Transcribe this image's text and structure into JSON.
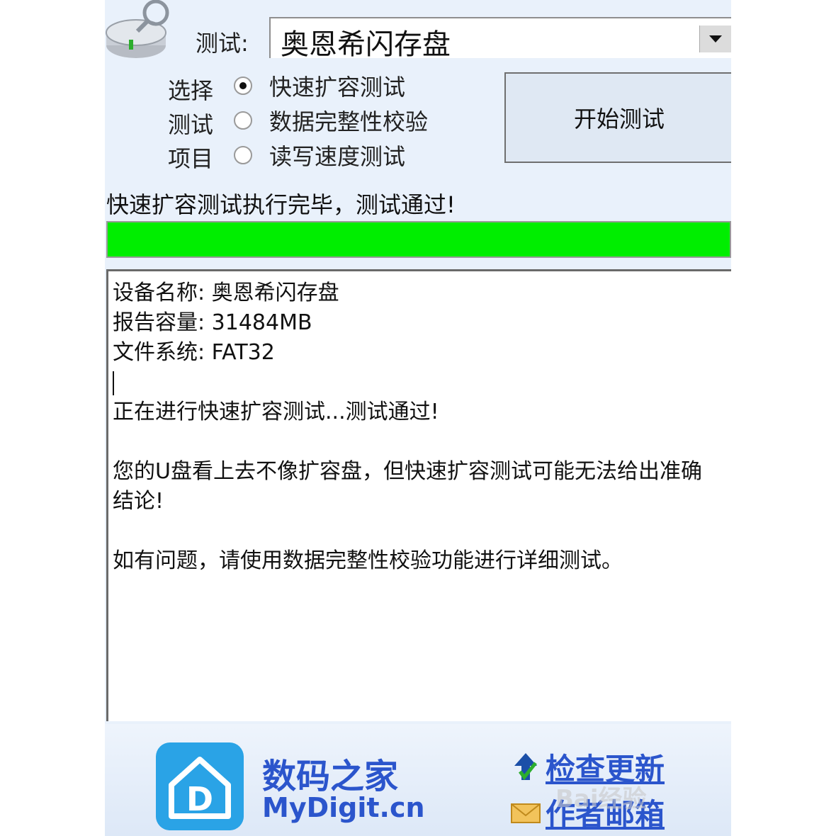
{
  "header": {
    "test_label": "测试:",
    "device_value": "奥恩希闪存盘"
  },
  "options": {
    "group_label": [
      "选择",
      "测试",
      "项目"
    ],
    "items": [
      {
        "label": "快速扩容测试",
        "checked": true
      },
      {
        "label": "数据完整性校验",
        "checked": false
      },
      {
        "label": "读写速度测试",
        "checked": false
      }
    ]
  },
  "start_button_label": "开始测试",
  "status_text": "快速扩容测试执行完毕，测试通过!",
  "progress": {
    "percent": 100,
    "color": "#00ee00"
  },
  "log": {
    "lines": [
      "设备名称: 奥恩希闪存盘",
      "报告容量: 31484MB",
      "文件系统: FAT32",
      "",
      "正在进行快速扩容测试...测试通过!",
      "",
      "您的U盘看上去不像扩容盘，但快速扩容测试可能无法给出准确",
      "结论!",
      "",
      "如有问题，请使用数据完整性校验功能进行详细测试。"
    ]
  },
  "footer": {
    "brand_name": "数码之家",
    "brand_url": "MyDigit.cn",
    "check_update": "检查更新",
    "author_email": "作者邮箱",
    "watermark": "Bai经验"
  },
  "colors": {
    "link": "#2b55cc",
    "window_bg": "#e9f1fb"
  }
}
